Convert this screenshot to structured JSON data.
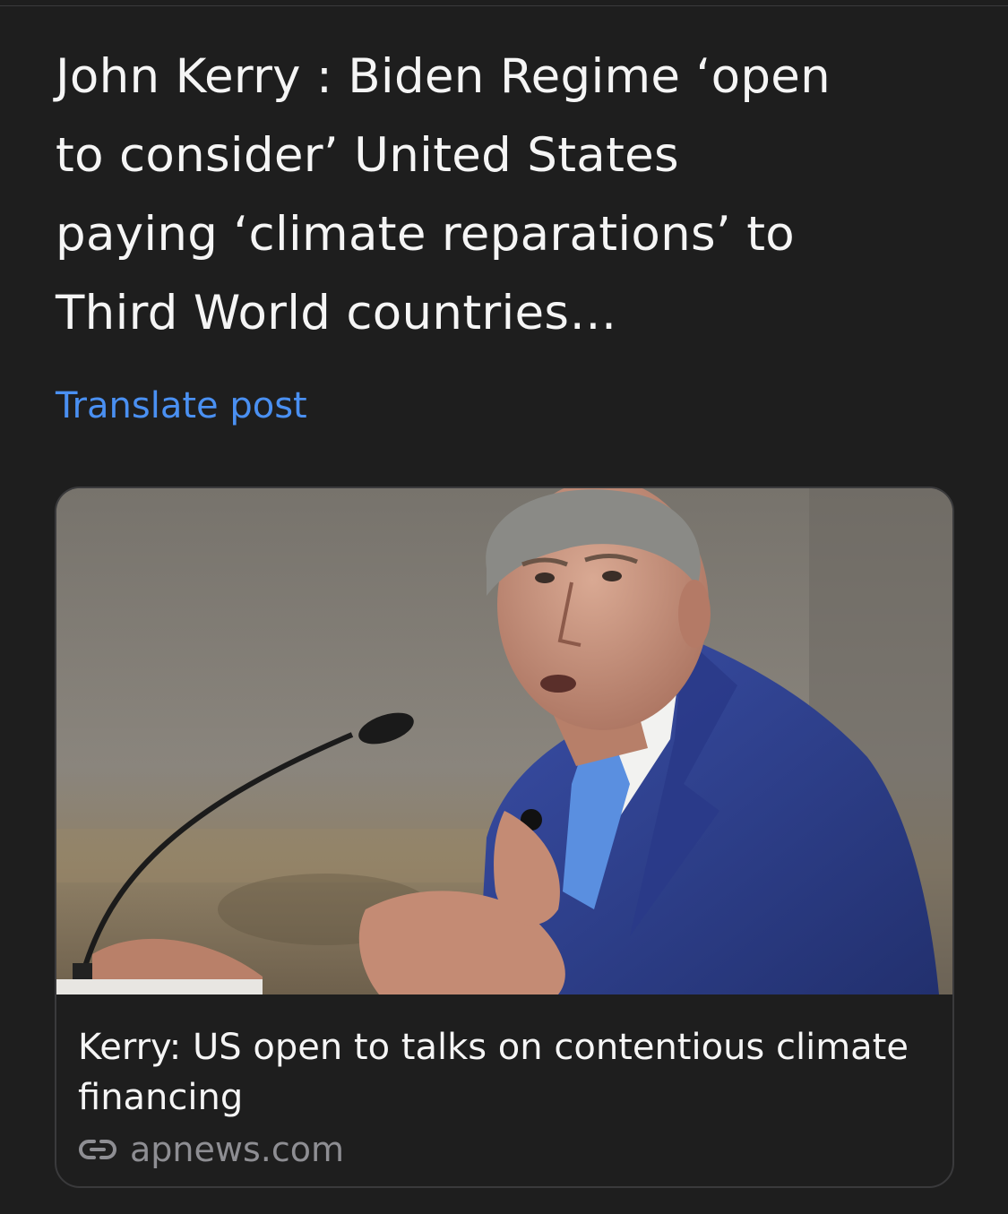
{
  "post": {
    "text": "John Kerry : Biden Regime ‘open\nto consider’ United States\npaying ‘climate reparations’ to\nThird World countries…",
    "translate_label": "Translate post"
  },
  "link_card": {
    "image_icon": "photo-john-kerry-speaking-at-podium",
    "title": "Kerry: US open to talks on contentious climate financing",
    "source_icon": "link-icon",
    "source": "apnews.com"
  },
  "colors": {
    "background": "#1e1e1e",
    "text": "#f5f5f5",
    "link": "#4a90f2",
    "muted": "#8e8e93",
    "border": "#3a3a3c"
  }
}
